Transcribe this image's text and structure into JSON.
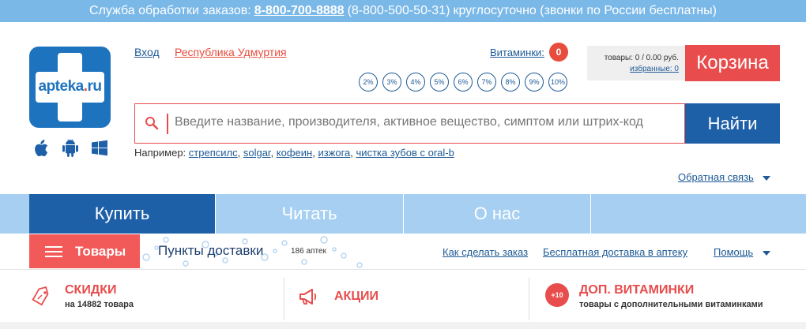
{
  "topbar": {
    "service_label": "Служба обработки заказов:",
    "phone_main": "8-800-700-8888",
    "phone_alt": "(8-800-500-50-31)",
    "note": "круглосуточно (звонки по России бесплатны)"
  },
  "logo": {
    "text_main": "apteka",
    "text_dot": ".",
    "text_tld": "ru"
  },
  "os_icons": [
    "apple-icon",
    "android-icon",
    "windows-icon"
  ],
  "header": {
    "login": "Вход",
    "region": "Республика Удмуртия",
    "vitamins_label": "Витаминки:",
    "vitamins_count": "0",
    "percents": [
      "2%",
      "3%",
      "4%",
      "5%",
      "6%",
      "7%",
      "8%",
      "9%",
      "10%"
    ]
  },
  "cart": {
    "summary": "товары: 0 / 0.00 руб.",
    "favorites": "избранные: 0",
    "button": "Корзина"
  },
  "search": {
    "placeholder": "Введите название, производителя, активное вещество, симптом или штрих-код",
    "button": "Найти",
    "examples_label": "Например:",
    "examples": [
      "стрепсилс",
      "solgar",
      "кофеин",
      "изжога",
      "чистка зубов с oral-b"
    ]
  },
  "feedback": "Обратная связь",
  "nav": {
    "tabs": [
      "Купить",
      "Читать",
      "О нас"
    ]
  },
  "subbar": {
    "goods": "Товары",
    "pickup": "Пункты доставки",
    "pharm_count": "186 аптек",
    "how_to_order": "Как сделать заказ",
    "free_delivery": "Бесплатная доставка в аптеку",
    "help": "Помощь"
  },
  "promo": {
    "discounts_title": "СКИДКИ",
    "discounts_sub": "на 14882 товара",
    "actions_title": "АКЦИИ",
    "vit_badge": "+10",
    "vit_title": "ДОП. ВИТАМИНКИ",
    "vit_sub": "товары с дополнительными витаминками"
  },
  "colors": {
    "accent_red": "#e84c4c",
    "brand_blue": "#1e60a8",
    "topbar_blue": "#7ab8e8",
    "nav_light": "#a6cff2"
  }
}
